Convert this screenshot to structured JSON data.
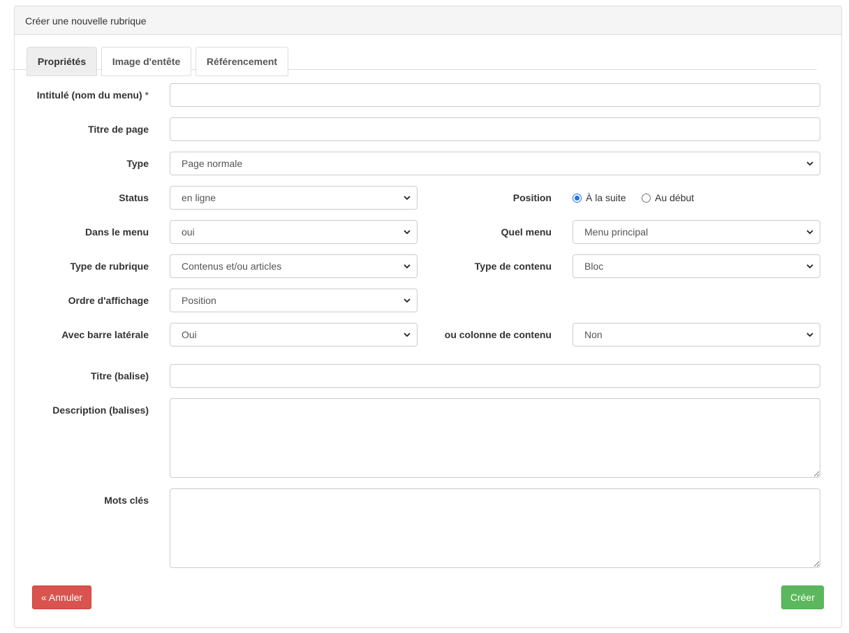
{
  "panel": {
    "title": "Créer une nouvelle rubrique"
  },
  "tabs": [
    {
      "label": "Propriétés",
      "active": true
    },
    {
      "label": "Image d'entête",
      "active": false
    },
    {
      "label": "Référencement",
      "active": false
    }
  ],
  "form": {
    "intitule": {
      "label": "Intitulé (nom du menu)",
      "required_mark": "*",
      "value": ""
    },
    "titre_page": {
      "label": "Titre de page",
      "value": ""
    },
    "type": {
      "label": "Type",
      "value": "Page normale"
    },
    "status": {
      "label": "Status",
      "value": "en ligne"
    },
    "position": {
      "label": "Position",
      "options": [
        {
          "label": "À la suite",
          "checked": true
        },
        {
          "label": "Au début",
          "checked": false
        }
      ]
    },
    "dans_menu": {
      "label": "Dans le menu",
      "value": "oui"
    },
    "quel_menu": {
      "label": "Quel menu",
      "value": "Menu principal"
    },
    "type_rubrique": {
      "label": "Type de rubrique",
      "value": "Contenus et/ou articles"
    },
    "type_contenu": {
      "label": "Type de contenu",
      "value": "Bloc"
    },
    "ordre_affichage": {
      "label": "Ordre d'affichage",
      "value": "Position"
    },
    "barre_laterale": {
      "label": "Avec barre latérale",
      "value": "Oui"
    },
    "colonne_contenu": {
      "label": "ou colonne de contenu",
      "value": "Non"
    },
    "titre_balise": {
      "label": "Titre (balise)",
      "value": ""
    },
    "description_balises": {
      "label": "Description (balises)",
      "value": ""
    },
    "mots_cles": {
      "label": "Mots clés",
      "value": ""
    }
  },
  "buttons": {
    "cancel": "« Annuler",
    "create": "Créer"
  },
  "colors": {
    "cancel": "#d9534f",
    "create": "#5cb85c",
    "radio_accent": "#1a73e8"
  },
  "icons": {
    "select": "chevron-down-icon"
  }
}
